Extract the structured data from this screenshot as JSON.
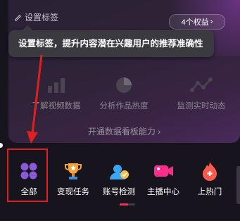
{
  "card": {
    "set_tag_label": "设置标签",
    "benefits_label": "4个权益",
    "tooltip": "设置标签，提升内容潜在兴趣用户的推荐准确性",
    "features": [
      {
        "label": "了解视频数据",
        "icon": "bar-chart-icon"
      },
      {
        "label": "分析作品热度",
        "icon": "pie-chart-icon"
      },
      {
        "label": "监测实时动态",
        "icon": "line-trend-icon"
      }
    ],
    "open_board_label": "开通数据看板能力"
  },
  "tools": [
    {
      "label": "全部",
      "icon": "grid-icon",
      "color": "#8a5bd8"
    },
    {
      "label": "变现任务",
      "icon": "trophy-icon",
      "color": "#f2a43a"
    },
    {
      "label": "账号检测",
      "icon": "health-check-icon",
      "color": "#3aa7f5"
    },
    {
      "label": "主播中心",
      "icon": "video-camera-icon",
      "color": "#fe2c8a"
    },
    {
      "label": "上热门",
      "icon": "flame-icon",
      "color": "#ff5a4e"
    }
  ],
  "colors": {
    "annotation": "#e02020",
    "accent": "#fe2c55"
  }
}
